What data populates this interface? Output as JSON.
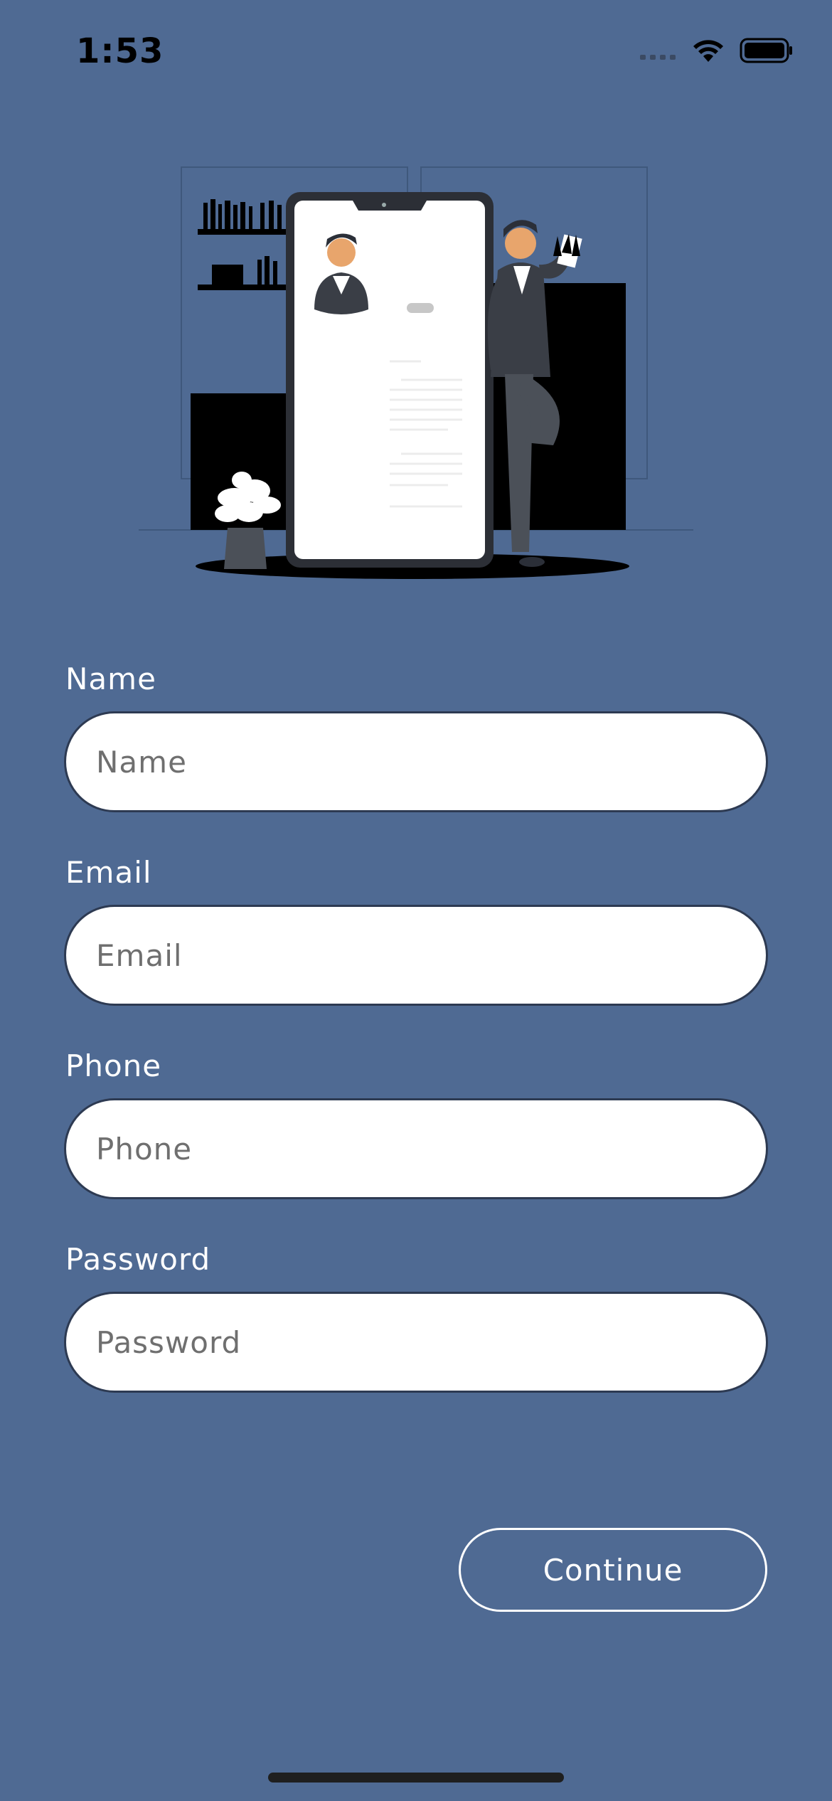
{
  "status_bar": {
    "time": "1:53"
  },
  "illustration": {
    "name": "people-with-phone-illustration"
  },
  "form": {
    "fields": [
      {
        "label": "Name",
        "placeholder": "Name",
        "value": ""
      },
      {
        "label": "Email",
        "placeholder": "Email",
        "value": ""
      },
      {
        "label": "Phone",
        "placeholder": "Phone",
        "value": ""
      },
      {
        "label": "Password",
        "placeholder": "Password",
        "value": ""
      }
    ],
    "continue_label": "Continue"
  },
  "colors": {
    "background": "#4f6a93",
    "input_background": "#ffffff",
    "input_border": "#2d3a52",
    "text_on_background": "#ffffff"
  },
  "icons": {
    "signal": "cellular-signal-icon",
    "wifi": "wifi-icon",
    "battery": "battery-icon"
  }
}
